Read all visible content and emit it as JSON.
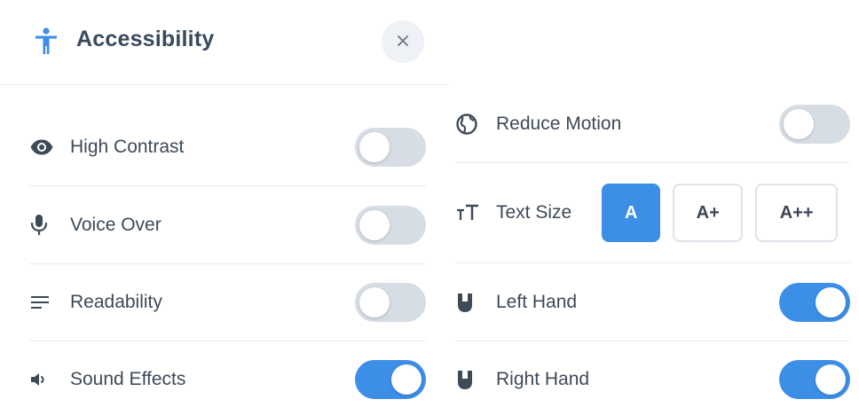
{
  "panel": {
    "title": "Accessibility",
    "close_label": "×"
  },
  "left_settings": [
    {
      "label": "High Contrast",
      "icon": "eye-icon",
      "enabled": false
    },
    {
      "label": "Voice Over",
      "icon": "microphone-icon",
      "enabled": false
    },
    {
      "label": "Readability",
      "icon": "lines-icon",
      "enabled": false
    },
    {
      "label": "Sound Effects",
      "icon": "speaker-icon",
      "enabled": true
    }
  ],
  "right_settings": {
    "reduce_motion": {
      "label": "Reduce Motion",
      "icon": "globe-icon",
      "enabled": false
    },
    "text_size": {
      "label": "Text Size",
      "icon": "text-size-icon",
      "options": [
        "A",
        "A+",
        "A++"
      ],
      "selected": "A"
    },
    "left_hand": {
      "label": "Left Hand",
      "icon": "hand-icon",
      "enabled": true
    },
    "right_hand": {
      "label": "Right Hand",
      "icon": "hand-icon",
      "enabled": true
    }
  },
  "colors": {
    "accent": "#3d8ee6",
    "toggle_off": "#d7dde4",
    "text": "#3d4a58"
  }
}
